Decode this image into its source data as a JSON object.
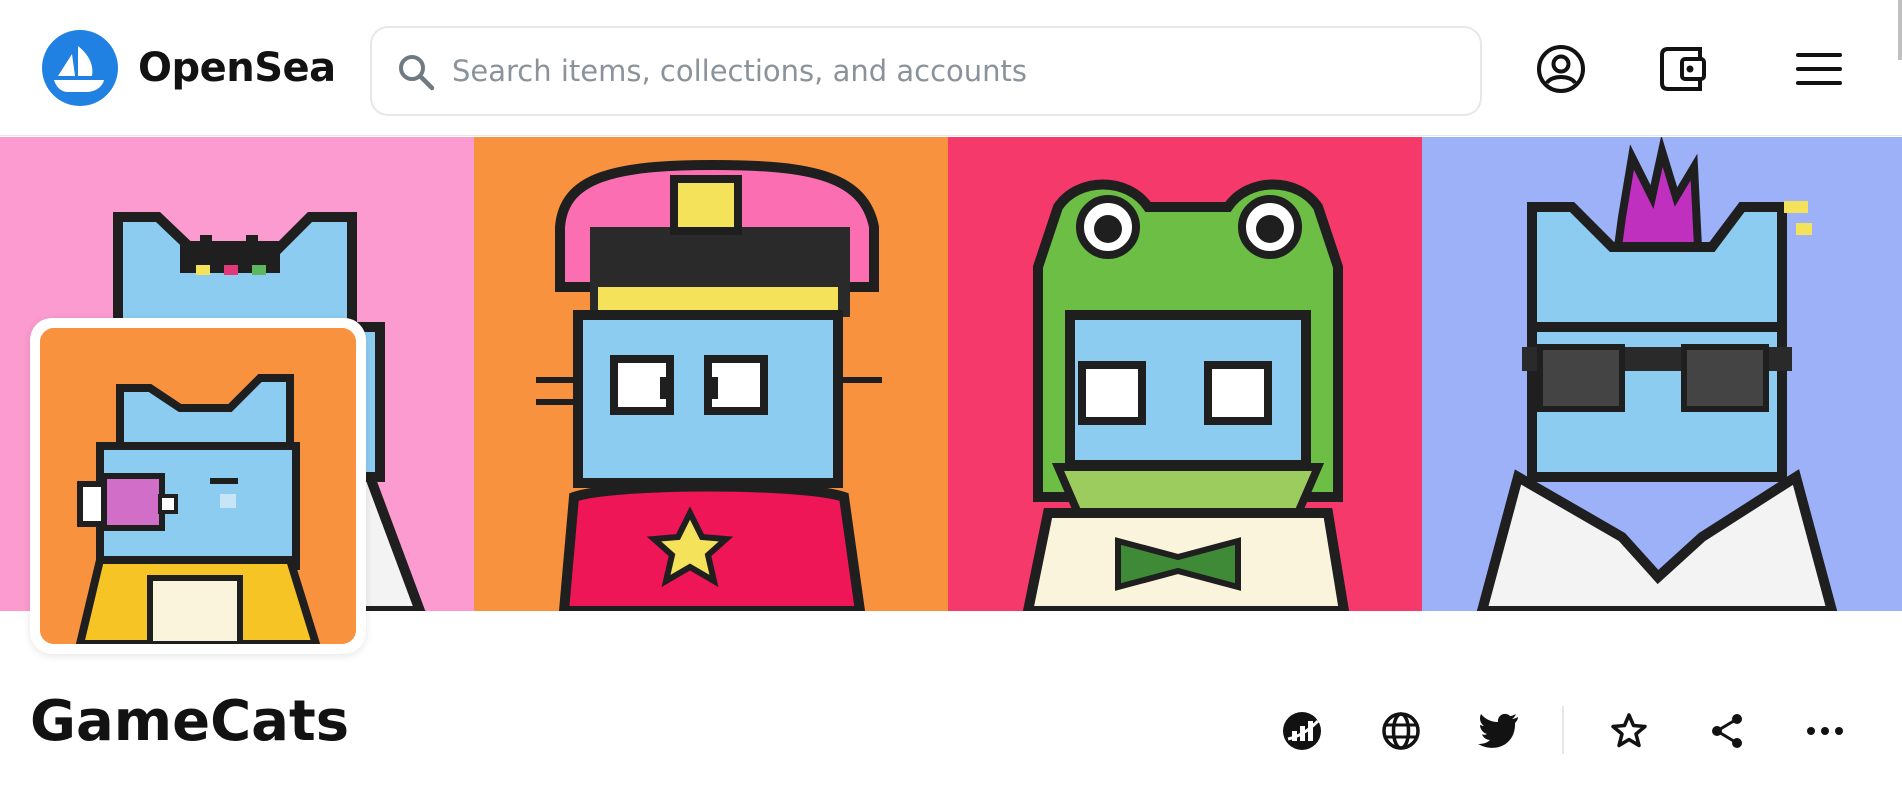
{
  "header": {
    "brand": "OpenSea",
    "search_placeholder": "Search items, collections, and accounts",
    "icons": [
      "opensea-logo-icon",
      "search-icon",
      "account-icon",
      "wallet-icon",
      "menu-icon"
    ]
  },
  "banner": {
    "panels": [
      {
        "name": "cat-crown",
        "background": "#fb9bcf"
      },
      {
        "name": "cat-captain",
        "background": "#f9923f"
      },
      {
        "name": "cat-frog-hood",
        "background": "#f5396b"
      },
      {
        "name": "cat-punk-shades",
        "background": "#9db1f9"
      }
    ]
  },
  "collection": {
    "name": "GameCats",
    "avatar_background": "#f9923f"
  },
  "actions": {
    "icons": [
      "activity-icon",
      "website-icon",
      "twitter-icon",
      "watchlist-star-icon",
      "share-icon",
      "more-icon"
    ]
  },
  "colors": {
    "accent": "#2081e2",
    "text": "#121212",
    "muted": "#8a939b",
    "cat_blue": "#8cccf1"
  }
}
